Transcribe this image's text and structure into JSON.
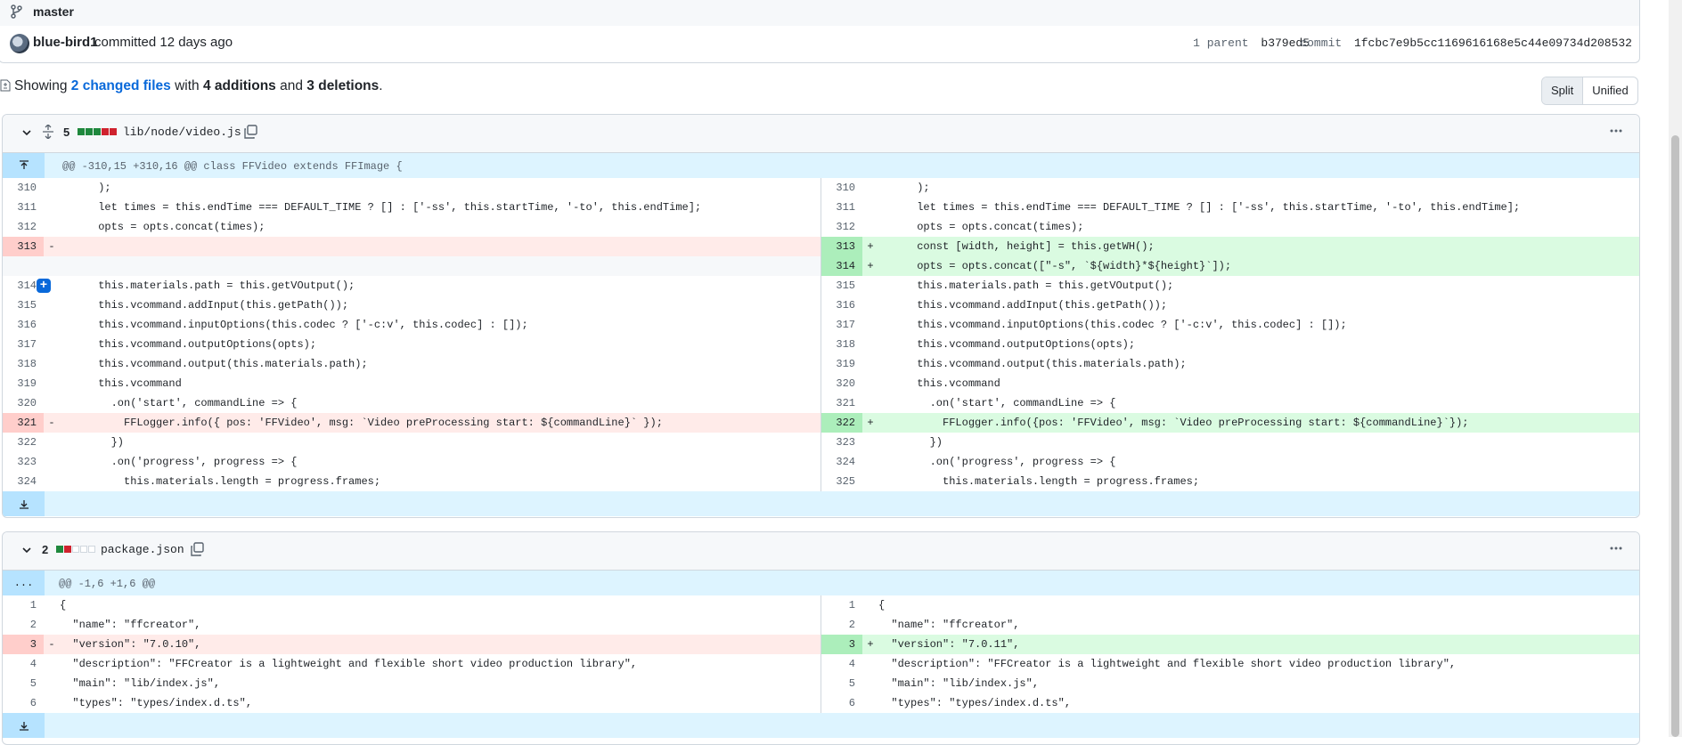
{
  "branch": {
    "name": "master"
  },
  "commit": {
    "author": "blue-bird1",
    "text": "committed 12 days ago",
    "parent_label": "1 parent",
    "parent_hash": "b379ed5",
    "commit_label": "commit",
    "commit_hash": "1fcbc7e9b5cc1169616168e5c44e09734d208532"
  },
  "summary": {
    "prefix": "Showing",
    "changed": "2 changed files",
    "with": "with",
    "additions": "4 additions",
    "and": "and",
    "deletions": "3 deletions",
    "end": "."
  },
  "view_toggle": {
    "split": "Split",
    "unified": "Unified"
  },
  "files": [
    {
      "count": "5",
      "name": "lib/node/video.js",
      "diffstat": [
        "add",
        "add",
        "add",
        "del",
        "del"
      ],
      "hunk": "@@ -310,15 +310,16 @@ class FFVideo extends FFImage {",
      "rows": [
        {
          "l": {
            "n": "310",
            "c": "      );",
            "t": ""
          },
          "r": {
            "n": "310",
            "c": "      );",
            "t": ""
          }
        },
        {
          "l": {
            "n": "311",
            "c": "      let times = this.endTime === DEFAULT_TIME ? [] : ['-ss', this.startTime, '-to', this.endTime];",
            "t": ""
          },
          "r": {
            "n": "311",
            "c": "      let times = this.endTime === DEFAULT_TIME ? [] : ['-ss', this.startTime, '-to', this.endTime];",
            "t": ""
          }
        },
        {
          "l": {
            "n": "312",
            "c": "      opts = opts.concat(times);",
            "t": ""
          },
          "r": {
            "n": "312",
            "c": "      opts = opts.concat(times);",
            "t": ""
          }
        },
        {
          "l": {
            "n": "313",
            "c": "",
            "t": "del",
            "m": "-"
          },
          "r": {
            "n": "313",
            "c": "      const [width, height] = this.getWH();",
            "t": "add",
            "m": "+"
          }
        },
        {
          "l": {
            "n": "",
            "c": "",
            "t": "empty"
          },
          "r": {
            "n": "314",
            "c": "      opts = opts.concat([\"-s\", `${width}*${height}`]);",
            "t": "add",
            "m": "+"
          }
        },
        {
          "l": {
            "n": "314",
            "c": "      this.materials.path = this.getVOutput();",
            "t": "",
            "plus": true
          },
          "r": {
            "n": "315",
            "c": "      this.materials.path = this.getVOutput();",
            "t": ""
          }
        },
        {
          "l": {
            "n": "315",
            "c": "      this.vcommand.addInput(this.getPath());",
            "t": ""
          },
          "r": {
            "n": "316",
            "c": "      this.vcommand.addInput(this.getPath());",
            "t": ""
          }
        },
        {
          "l": {
            "n": "316",
            "c": "      this.vcommand.inputOptions(this.codec ? ['-c:v', this.codec] : []);",
            "t": ""
          },
          "r": {
            "n": "317",
            "c": "      this.vcommand.inputOptions(this.codec ? ['-c:v', this.codec] : []);",
            "t": ""
          }
        },
        {
          "l": {
            "n": "317",
            "c": "      this.vcommand.outputOptions(opts);",
            "t": ""
          },
          "r": {
            "n": "318",
            "c": "      this.vcommand.outputOptions(opts);",
            "t": ""
          }
        },
        {
          "l": {
            "n": "318",
            "c": "      this.vcommand.output(this.materials.path);",
            "t": ""
          },
          "r": {
            "n": "319",
            "c": "      this.vcommand.output(this.materials.path);",
            "t": ""
          }
        },
        {
          "l": {
            "n": "319",
            "c": "      this.vcommand",
            "t": ""
          },
          "r": {
            "n": "320",
            "c": "      this.vcommand",
            "t": ""
          }
        },
        {
          "l": {
            "n": "320",
            "c": "        .on('start', commandLine => {",
            "t": ""
          },
          "r": {
            "n": "321",
            "c": "        .on('start', commandLine => {",
            "t": ""
          }
        },
        {
          "l": {
            "n": "321",
            "c": "          FFLogger.info({ pos: 'FFVideo', msg: `Video preProcessing start: ${commandLine}` });",
            "t": "del",
            "m": "-"
          },
          "r": {
            "n": "322",
            "c": "          FFLogger.info({pos: 'FFVideo', msg: `Video preProcessing start: ${commandLine}`});",
            "t": "add",
            "m": "+"
          }
        },
        {
          "l": {
            "n": "322",
            "c": "        })",
            "t": ""
          },
          "r": {
            "n": "323",
            "c": "        })",
            "t": ""
          }
        },
        {
          "l": {
            "n": "323",
            "c": "        .on('progress', progress => {",
            "t": ""
          },
          "r": {
            "n": "324",
            "c": "        .on('progress', progress => {",
            "t": ""
          }
        },
        {
          "l": {
            "n": "324",
            "c": "          this.materials.length = progress.frames;",
            "t": ""
          },
          "r": {
            "n": "325",
            "c": "          this.materials.length = progress.frames;",
            "t": ""
          }
        }
      ]
    },
    {
      "count": "2",
      "name": "package.json",
      "diffstat": [
        "add",
        "del",
        "neu",
        "neu",
        "neu"
      ],
      "hunk": "@@ -1,6 +1,6 @@",
      "hunk_btn": "...",
      "rows": [
        {
          "l": {
            "n": "1",
            "c": "{",
            "t": ""
          },
          "r": {
            "n": "1",
            "c": "{",
            "t": ""
          }
        },
        {
          "l": {
            "n": "2",
            "c": "  \"name\": \"ffcreator\",",
            "t": ""
          },
          "r": {
            "n": "2",
            "c": "  \"name\": \"ffcreator\",",
            "t": ""
          }
        },
        {
          "l": {
            "n": "3",
            "c": "  \"version\": \"7.0.10\",",
            "t": "del",
            "m": "-"
          },
          "r": {
            "n": "3",
            "c": "  \"version\": \"7.0.11\",",
            "t": "add",
            "m": "+"
          }
        },
        {
          "l": {
            "n": "4",
            "c": "  \"description\": \"FFCreator is a lightweight and flexible short video production library\",",
            "t": ""
          },
          "r": {
            "n": "4",
            "c": "  \"description\": \"FFCreator is a lightweight and flexible short video production library\",",
            "t": ""
          }
        },
        {
          "l": {
            "n": "5",
            "c": "  \"main\": \"lib/index.js\",",
            "t": ""
          },
          "r": {
            "n": "5",
            "c": "  \"main\": \"lib/index.js\",",
            "t": ""
          }
        },
        {
          "l": {
            "n": "6",
            "c": "  \"types\": \"types/index.d.ts\",",
            "t": ""
          },
          "r": {
            "n": "6",
            "c": "  \"types\": \"types/index.d.ts\",",
            "t": ""
          }
        }
      ]
    }
  ]
}
